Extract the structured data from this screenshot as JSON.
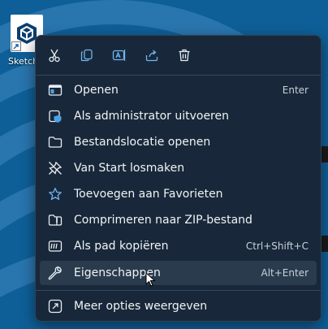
{
  "desktop": {
    "icon_label": "SketchUp"
  },
  "toolbar": {
    "cut_icon": "scissors-icon",
    "copy_icon": "copy-icon",
    "rename_icon": "rename-icon",
    "share_icon": "share-icon",
    "delete_icon": "trash-icon"
  },
  "menu": {
    "items": [
      {
        "label": "Openen",
        "shortcut": "Enter",
        "icon": "open-app-icon"
      },
      {
        "label": "Als administrator uitvoeren",
        "shortcut": "",
        "icon": "shield-icon"
      },
      {
        "label": "Bestandslocatie openen",
        "shortcut": "",
        "icon": "folder-icon"
      },
      {
        "label": "Van Start losmaken",
        "shortcut": "",
        "icon": "unpin-icon"
      },
      {
        "label": "Toevoegen aan Favorieten",
        "shortcut": "",
        "icon": "star-icon"
      },
      {
        "label": "Comprimeren naar ZIP-bestand",
        "shortcut": "",
        "icon": "zip-folder-icon"
      },
      {
        "label": "Als pad kopiëren",
        "shortcut": "Ctrl+Shift+C",
        "icon": "copy-path-icon"
      },
      {
        "label": "Eigenschappen",
        "shortcut": "Alt+Enter",
        "icon": "wrench-icon"
      }
    ],
    "more": {
      "label": "Meer opties weergeven",
      "icon": "more-options-icon"
    }
  },
  "colors": {
    "desktop_bg": "#0e5f98",
    "menu_bg": "#18283a",
    "hover_bg": "#2a3b4e",
    "text": "#f1f3f5"
  }
}
